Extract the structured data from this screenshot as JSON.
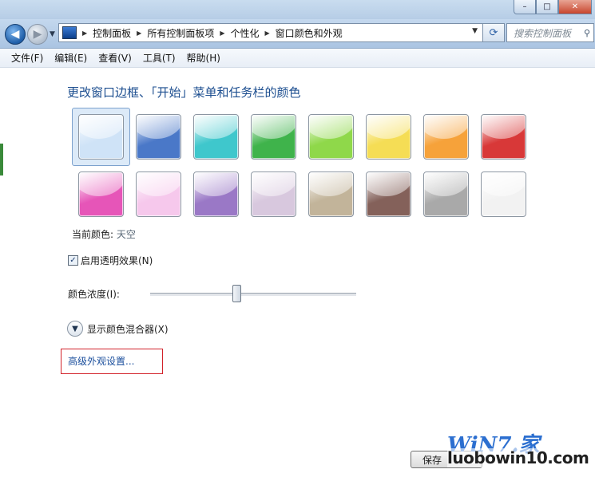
{
  "window": {
    "minimize_glyph": "–",
    "maximize_glyph": "□",
    "close_glyph": "✕"
  },
  "nav": {
    "back_glyph": "◀",
    "forward_glyph": "▶",
    "breadcrumbs": [
      "控制面板",
      "所有控制面板项",
      "个性化",
      "窗口颜色和外观"
    ],
    "search_placeholder": "搜索控制面板"
  },
  "menu": [
    "文件(F)",
    "编辑(E)",
    "查看(V)",
    "工具(T)",
    "帮助(H)"
  ],
  "page": {
    "heading": "更改窗口边框、「开始」菜单和任务栏的颜色",
    "current_color_label": "当前颜色:",
    "current_color_value": "天空",
    "transparency_label": "启用透明效果(N)",
    "transparency_checked": true,
    "intensity_label": "颜色浓度(I):",
    "intensity_level": 0.42,
    "mixer_label": "显示颜色混合器(X)",
    "advanced_link": "高级外观设置...",
    "save_label": "保存"
  },
  "swatches": [
    {
      "name": "sky",
      "color": "#cfe3f7",
      "selected": true
    },
    {
      "name": "twilight",
      "color": "#4a78c8"
    },
    {
      "name": "sea",
      "color": "#3fc7cc"
    },
    {
      "name": "leaf",
      "color": "#3fb34b"
    },
    {
      "name": "lime",
      "color": "#8fd84a"
    },
    {
      "name": "frost",
      "color": "#f5dd55"
    },
    {
      "name": "pumpkin",
      "color": "#f6a23a"
    },
    {
      "name": "ruby",
      "color": "#d83838"
    },
    {
      "name": "fuchsia",
      "color": "#e655b8"
    },
    {
      "name": "blush",
      "color": "#f6c8ec"
    },
    {
      "name": "violet",
      "color": "#9a78c6"
    },
    {
      "name": "lavender",
      "color": "#d8c8de"
    },
    {
      "name": "taupe",
      "color": "#c2b49a"
    },
    {
      "name": "chocolate",
      "color": "#84615a"
    },
    {
      "name": "slate",
      "color": "#a9a9a9"
    },
    {
      "name": "frost-white",
      "color": "#f2f2f2"
    }
  ],
  "watermark": {
    "logo": "WiN7.家",
    "url": "luobowin10.com"
  }
}
